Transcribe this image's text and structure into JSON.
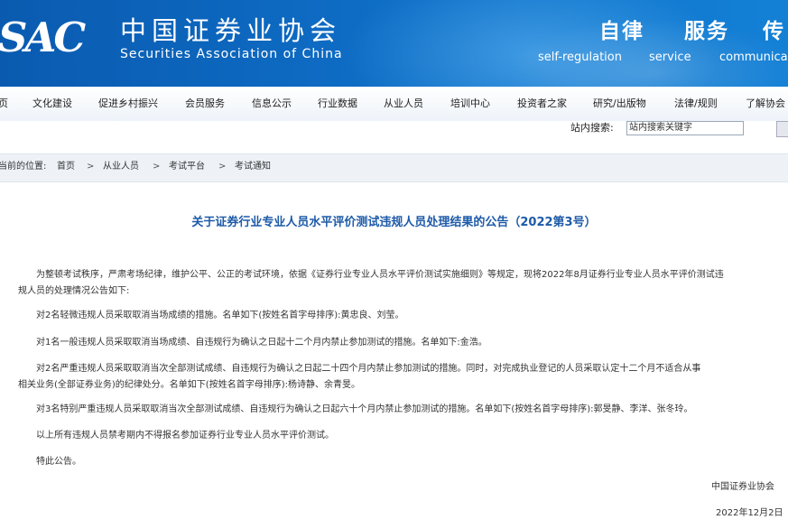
{
  "header": {
    "logo_mark": "SAC",
    "name_cn": "中国证券业协会",
    "name_en": "Securities Association of China",
    "slogans": [
      {
        "cn": "自律",
        "en": "self-regulation"
      },
      {
        "cn": "服务",
        "en": "service"
      },
      {
        "cn": "传",
        "en": "communica"
      }
    ]
  },
  "nav": {
    "items": [
      "页",
      "文化建设",
      "促进乡村振兴",
      "会员服务",
      "信息公示",
      "行业数据",
      "从业人员",
      "培训中心",
      "投资者之家",
      "研究/出版物",
      "法律/规则",
      "了解协会"
    ]
  },
  "search": {
    "label": "站内搜索:",
    "placeholder": "站内搜索关键字"
  },
  "breadcrumb": {
    "prefix": "当前的位置:",
    "items": [
      "首页",
      "从业人员",
      "考试平台",
      "考试通知"
    ],
    "separator": ">"
  },
  "article": {
    "title": "关于证券行业专业人员水平评价测试违规人员处理结果的公告（2022第3号）",
    "paragraphs": [
      "为整顿考试秩序，严肃考场纪律，维护公平、公正的考试环境，依据《证券行业专业人员水平评价测试实施细则》等规定，现将2022年8月证券行业专业人员水平评价测试违",
      "规人员的处理情况公告如下:",
      "对2名轻微违规人员采取取消当场成绩的措施。名单如下(按姓名首字母排序):黄忠良、刘莹。",
      "对1名一般违规人员采取取消当场成绩、自违规行为确认之日起十二个月内禁止参加测试的措施。名单如下:金浩。",
      "对2名严重违规人员采取取消当次全部测试成绩、自违规行为确认之日起二十四个月内禁止参加测试的措施。同时，对完成执业登记的人员采取认定十二个月不适合从事",
      "相关业务(全部证券业务)的纪律处分。名单如下(按姓名首字母排序):杨诗静、余青旻。",
      "对3名特别严重违规人员采取取消当次全部测试成绩、自违规行为确认之日起六十个月内禁止参加测试的措施。名单如下(按姓名首字母排序):郭旻静、李洋、张冬玲。",
      "以上所有违规人员禁考期内不得报名参加证券行业专业人员水平评价测试。",
      "特此公告。"
    ],
    "signature": "中国证券业协会",
    "date": "2022年12月2日"
  }
}
